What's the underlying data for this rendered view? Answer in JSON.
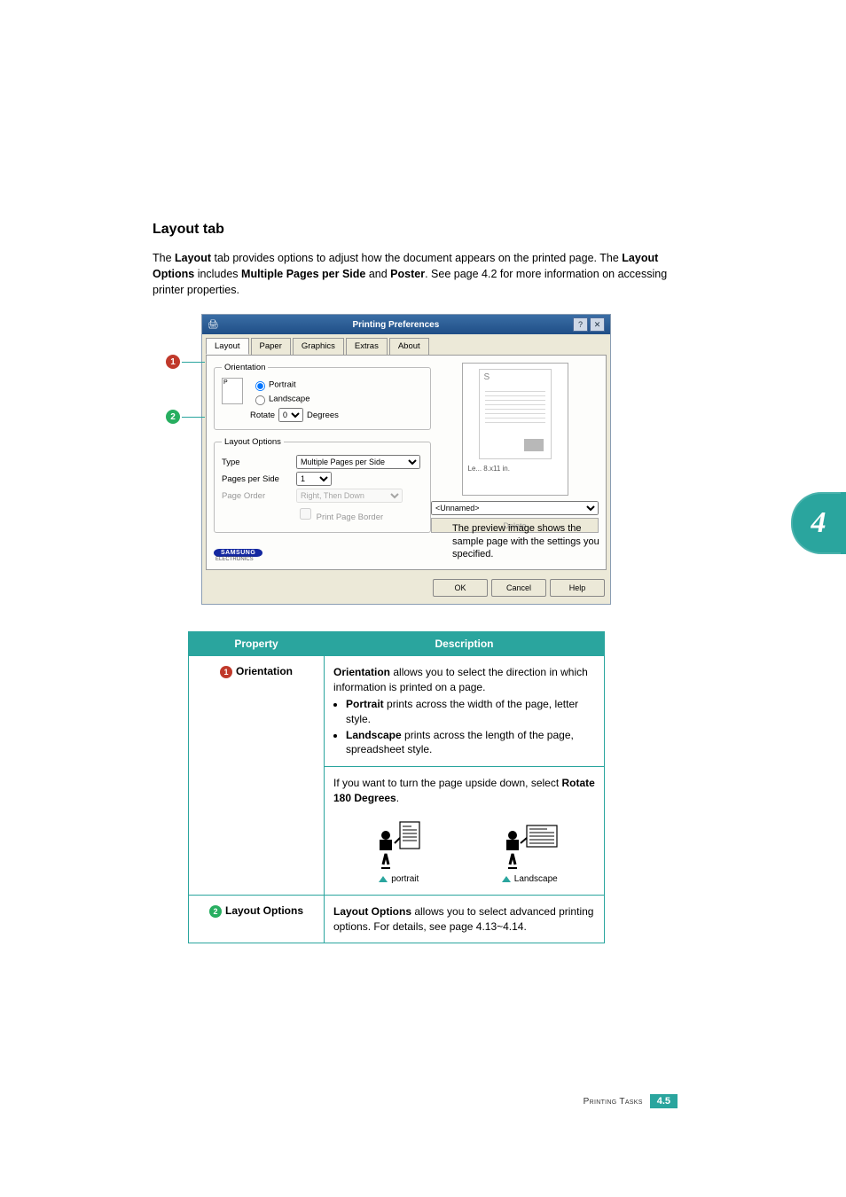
{
  "side_badge": "4",
  "section_title": "Layout tab",
  "intro": {
    "prefix": "The ",
    "b1": "Layout",
    "mid1": " tab provides options to adjust how the document appears on the printed page. The ",
    "b2": "Layout Options",
    "mid2": " includes ",
    "b3": "Multiple Pages per Side",
    "mid3": " and ",
    "b4": "Poster",
    "suffix": ". See page 4.2 for more information on accessing printer properties."
  },
  "dialog": {
    "title": "Printing Preferences",
    "help_btn": "?",
    "close_btn": "✕",
    "tabs": [
      "Layout",
      "Paper",
      "Graphics",
      "Extras",
      "About"
    ],
    "active_tab": 0,
    "groups": {
      "orientation": {
        "legend": "Orientation",
        "thumb_letter": "P",
        "opt_portrait": "Portrait",
        "opt_landscape": "Landscape",
        "rotate_label": "Rotate",
        "rotate_value": "0",
        "rotate_unit": "Degrees"
      },
      "layout_options": {
        "legend": "Layout Options",
        "type_label": "Type",
        "type_value": "Multiple Pages per Side",
        "pps_label": "Pages per Side",
        "pps_value": "1",
        "order_label": "Page Order",
        "order_value": "Right, Then Down",
        "print_border": "Print Page Border"
      }
    },
    "preview": {
      "letter": "S",
      "info": "Le...    8.x11 in."
    },
    "preview_callout": "The preview image shows the sample page with the settings you specified.",
    "favorites": {
      "value": "<Unnamed>",
      "delete": "Delete"
    },
    "footer": {
      "ok": "OK",
      "cancel": "Cancel",
      "help": "Help"
    },
    "logo_brand": "SAMSUNG",
    "logo_sub": "ELECTRONICS"
  },
  "callouts": {
    "one": "1",
    "two": "2"
  },
  "table": {
    "header_prop": "Property",
    "header_desc": "Description",
    "row1": {
      "label": "Orientation",
      "desc": {
        "b1": "Orientation",
        "t1": " allows you to select the direction in which information is printed on a page.",
        "li1b": "Portrait",
        "li1t": " prints across the width of the page, letter style.",
        "li2b": "Landscape",
        "li2t": " prints across the length of the page, spreadsheet style.",
        "t2a": "If you want to turn the page upside down, select ",
        "t2b": "Rotate 180 Degrees",
        "t2c": ".",
        "illust_portrait": "portrait",
        "illust_landscape": "Landscape"
      }
    },
    "row2": {
      "label": "Layout Options",
      "desc_b": "Layout Options",
      "desc_t": " allows you to select advanced printing options. For details, see page 4.13~4.14."
    }
  },
  "footer": {
    "label": "Printing Tasks",
    "page": "4.5"
  }
}
